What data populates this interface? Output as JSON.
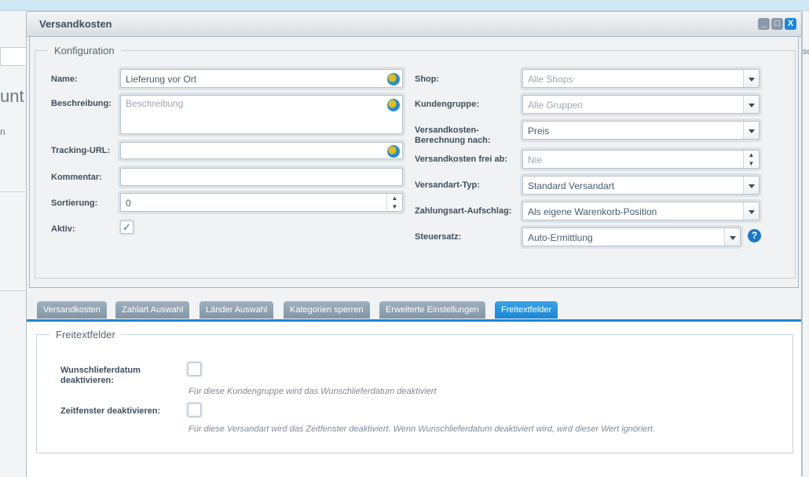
{
  "window": {
    "title": "Versandkosten",
    "minimize": "_",
    "maximize": "□",
    "close": "X"
  },
  "background": {
    "left_text": "unt",
    "left_text2": "n",
    "right_text": "sc"
  },
  "config": {
    "legend": "Konfiguration",
    "name": {
      "label": "Name:",
      "value": "Lieferung vor Ort"
    },
    "beschreibung": {
      "label": "Beschreibung:",
      "placeholder": "Beschreibung"
    },
    "tracking": {
      "label": "Tracking-URL:",
      "value": ""
    },
    "kommentar": {
      "label": "Kommentar:",
      "value": ""
    },
    "sortierung": {
      "label": "Sortierung:",
      "value": "0"
    },
    "aktiv": {
      "label": "Aktiv:",
      "checked": true,
      "mark": "✓"
    },
    "shop": {
      "label": "Shop:",
      "placeholder": "Alle Shops"
    },
    "kundengruppe": {
      "label": "Kundengruppe:",
      "placeholder": "Alle Gruppen"
    },
    "berechnung": {
      "label_line1": "Versandkosten-",
      "label_line2": "Berechnung nach:",
      "value": "Preis"
    },
    "frei_ab": {
      "label": "Versandkosten frei ab:",
      "placeholder": "Nie"
    },
    "typ": {
      "label": "Versandart-Typ:",
      "value": "Standard Versandart"
    },
    "aufschlag": {
      "label": "Zahlungsart-Aufschlag:",
      "value": "Als eigene Warenkorb-Position"
    },
    "steuersatz": {
      "label": "Steuersatz:",
      "value": "Auto-Ermittlung",
      "help": "?"
    }
  },
  "tabs": [
    {
      "label": "Versandkosten",
      "active": false
    },
    {
      "label": "Zahlart Auswahl",
      "active": false
    },
    {
      "label": "Länder Auswahl",
      "active": false
    },
    {
      "label": "Kategorien sperren",
      "active": false
    },
    {
      "label": "Erweiterte Einstellungen",
      "active": false
    },
    {
      "label": "Freitextfelder",
      "active": true
    }
  ],
  "freitext": {
    "legend": "Freitextfelder",
    "wunsch": {
      "label_line1": "Wunschlieferdatum",
      "label_line2": "deaktivieren:",
      "checked": false,
      "hint": "Für diese Kundengruppe wird das Wunschlieferdatum deaktiviert"
    },
    "zeitfenster": {
      "label": "Zeitfenster deaktivieren:",
      "checked": false,
      "hint": "Für diese Versandart wird das Zeitfenster deaktiviert. Wenn Wunschlieferdatum deaktiviert wird, wird dieser Wert ignoriert."
    }
  },
  "colors": {
    "accent": "#1c86d4",
    "tab_inactive": "#8d9fad",
    "topbar": "#cfe9f4"
  }
}
